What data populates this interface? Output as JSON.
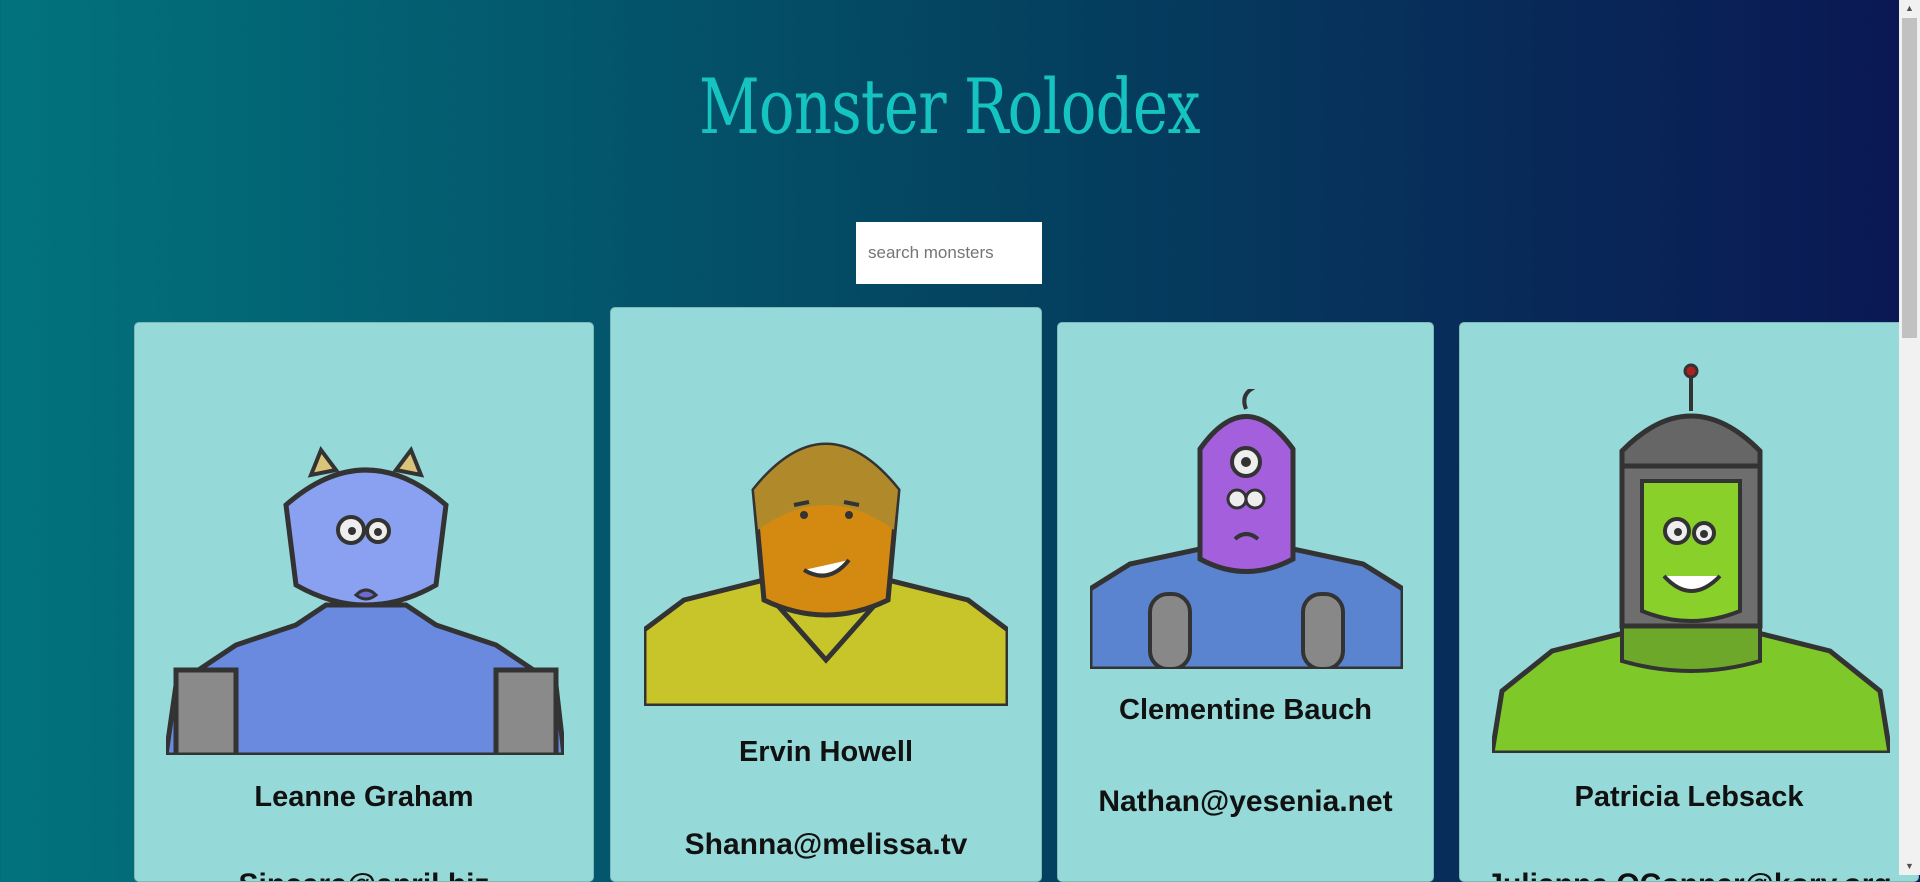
{
  "app": {
    "title": "Monster Rolodex"
  },
  "search": {
    "placeholder": "search monsters",
    "value": ""
  },
  "monsters": [
    {
      "name": "Leanne Graham",
      "email": "Sincere@april.biz"
    },
    {
      "name": "Ervin Howell",
      "email": "Shanna@melissa.tv"
    },
    {
      "name": "Clementine Bauch",
      "email": "Nathan@yesenia.net"
    },
    {
      "name": "Patricia Lebsack",
      "email": "Julianne.OConner@kory.org"
    }
  ],
  "colors": {
    "card": "#95dad9",
    "title": "#15c4c0"
  }
}
